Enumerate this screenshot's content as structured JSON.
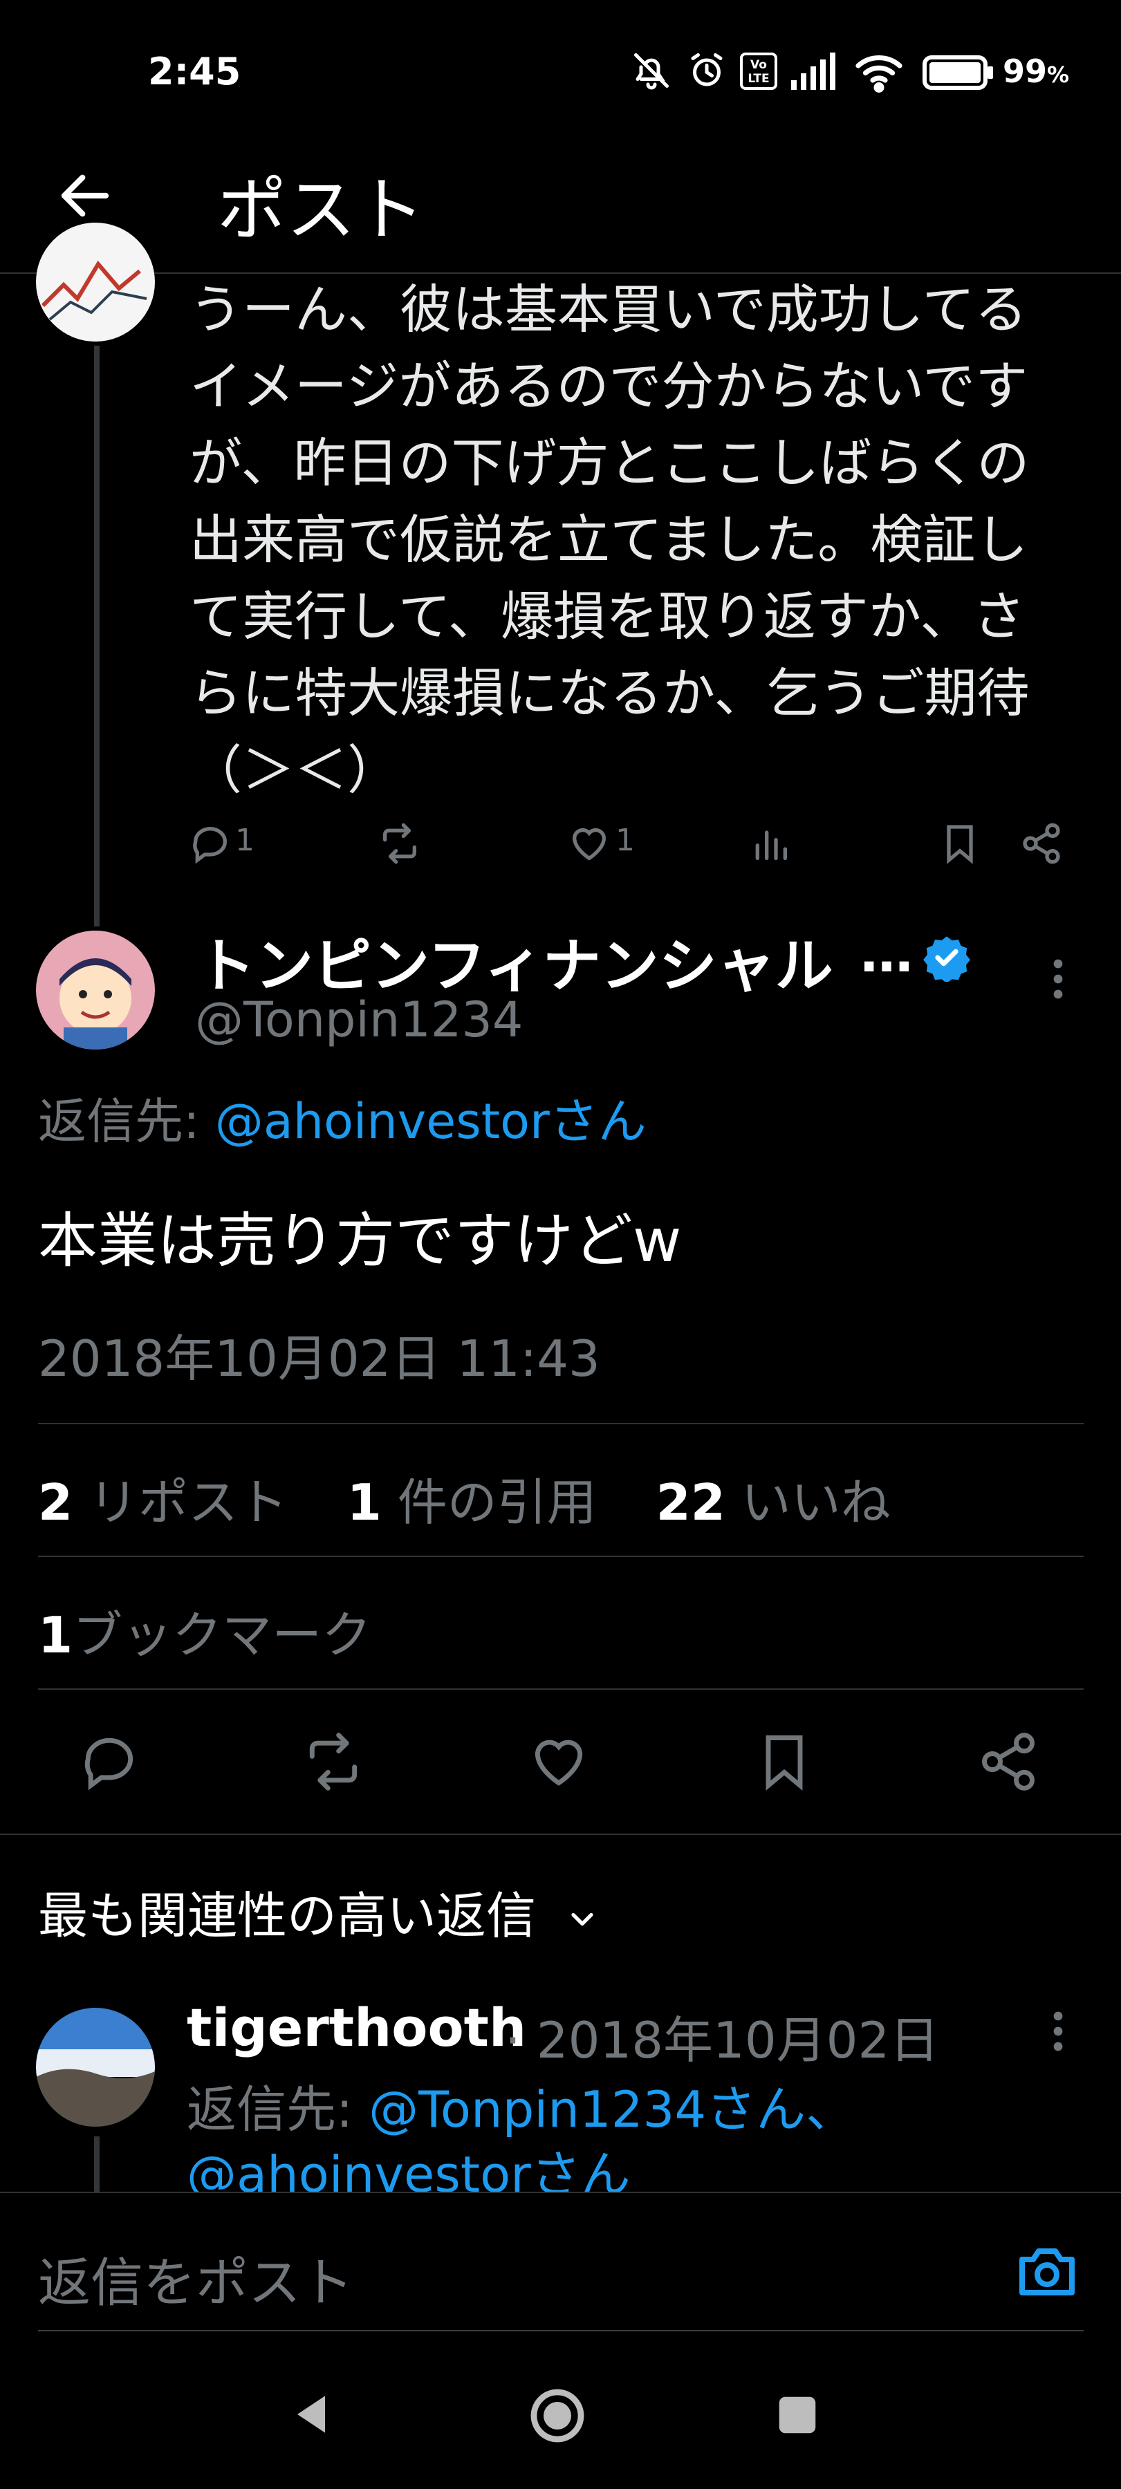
{
  "status_bar": {
    "time": "2:45",
    "battery_percent": "99",
    "battery_unit": "%",
    "icons": [
      "bell-off-icon",
      "alarm-icon",
      "volte-icon",
      "signal-icon",
      "wifi-icon",
      "battery-icon"
    ]
  },
  "header": {
    "title": "ポスト"
  },
  "previous_reply": {
    "text_lines": [
      "うーん、彼は基本買いで成功してる",
      "イメージがあるので分からないです",
      "が、昨日の下げ方とここしばらくの",
      "出来高で仮説を立てました。検証し",
      "て実行して、爆損を取り返すか、さ",
      "らに特大爆損になるか、乞うご期待",
      "（＞＜）"
    ],
    "reply_count": "1",
    "like_count": "1"
  },
  "main_tweet": {
    "display_name": "トンピンフィナンシャル",
    "ellipsis": "…",
    "handle": "@Tonpin1234",
    "reply_to_prefix": "返信先: ",
    "reply_to_user": "@ahoinvestorさん",
    "text": "本業は売り方ですけどw",
    "timestamp": "2018年10月02日 11:43",
    "reposts_count": "2",
    "reposts_label": "リポスト",
    "quotes_count": "1",
    "quotes_label": "件の引用",
    "likes_count": "22",
    "likes_label": "いいね",
    "bookmarks_count": "1",
    "bookmarks_label": "ブックマーク"
  },
  "replies_section": {
    "title": "最も関連性の高い返信",
    "reply": {
      "name": "tigerthooth",
      "separator": "·",
      "date": "2018年10月02日",
      "reply_to_prefix": "返信先: ",
      "reply_to_user_1": "@Tonpin1234さん、",
      "reply_to_user_2": "@ahoinvestorさん"
    }
  },
  "compose": {
    "placeholder": "返信をポスト"
  },
  "colors": {
    "accent": "#1d9bf0",
    "background": "#000000",
    "text": "#e7e9ea",
    "secondary": "#71767b",
    "divider": "#2f3336"
  }
}
